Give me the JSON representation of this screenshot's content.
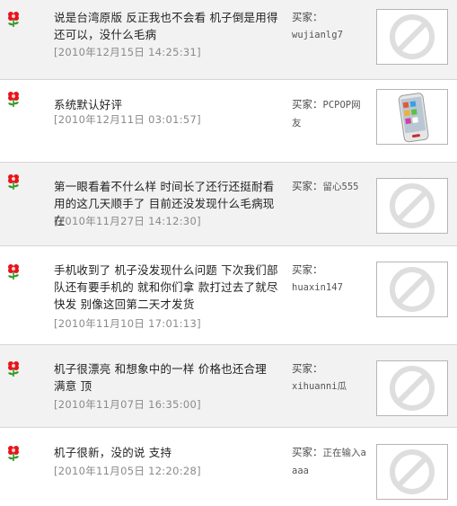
{
  "reviews": [
    {
      "comment": "说是台湾原版 反正我也不会看 机子倒是用得还可以，没什么毛病",
      "date": "[2010年12月15日 14:25:31]",
      "buyer_prefix": "买家：",
      "buyer_name": "wujianlg7",
      "thumb_icon": "no-image-icon"
    },
    {
      "comment": "系统默认好评",
      "date": "[2010年12月11日 03:01:57]",
      "buyer_prefix": "买家：",
      "buyer_name": "PCPOP网友",
      "thumb_icon": "phone-photo"
    },
    {
      "comment": "第一眼看着不什么样 时间长了还行还挺耐看用的这几天顺手了 目前还没发现什么毛病现在",
      "date": "[2010年11月27日 14:12:30]",
      "buyer_prefix": "买家：",
      "buyer_name": "留心555",
      "thumb_icon": "no-image-icon"
    },
    {
      "comment": "手机收到了 机子没发现什么问题 下次我们部队还有要手机的 就和你们拿 款打过去了就尽快发 别像这回第二天才发货",
      "date": "[2010年11月10日 17:01:13]",
      "buyer_prefix": "买家：",
      "buyer_name": "huaxin147",
      "thumb_icon": "no-image-icon"
    },
    {
      "comment": "机子很漂亮 和想象中的一样 价格也还合理 满意 顶",
      "date": "[2010年11月07日 16:35:00]",
      "buyer_prefix": "买家：",
      "buyer_name": "xihuanni瓜",
      "thumb_icon": "no-image-icon"
    },
    {
      "comment": "机子很新，没的说 支持",
      "date": "[2010年11月05日 12:20:28]",
      "buyer_prefix": "买家：",
      "buyer_name": "正在输入aaaa",
      "thumb_icon": "no-image-icon"
    }
  ],
  "colors": {
    "flower_red": "#e8141b",
    "leaf_green": "#2f9a24",
    "date_gray": "#8a8a8a",
    "row_alt": "#f2f2f2"
  }
}
